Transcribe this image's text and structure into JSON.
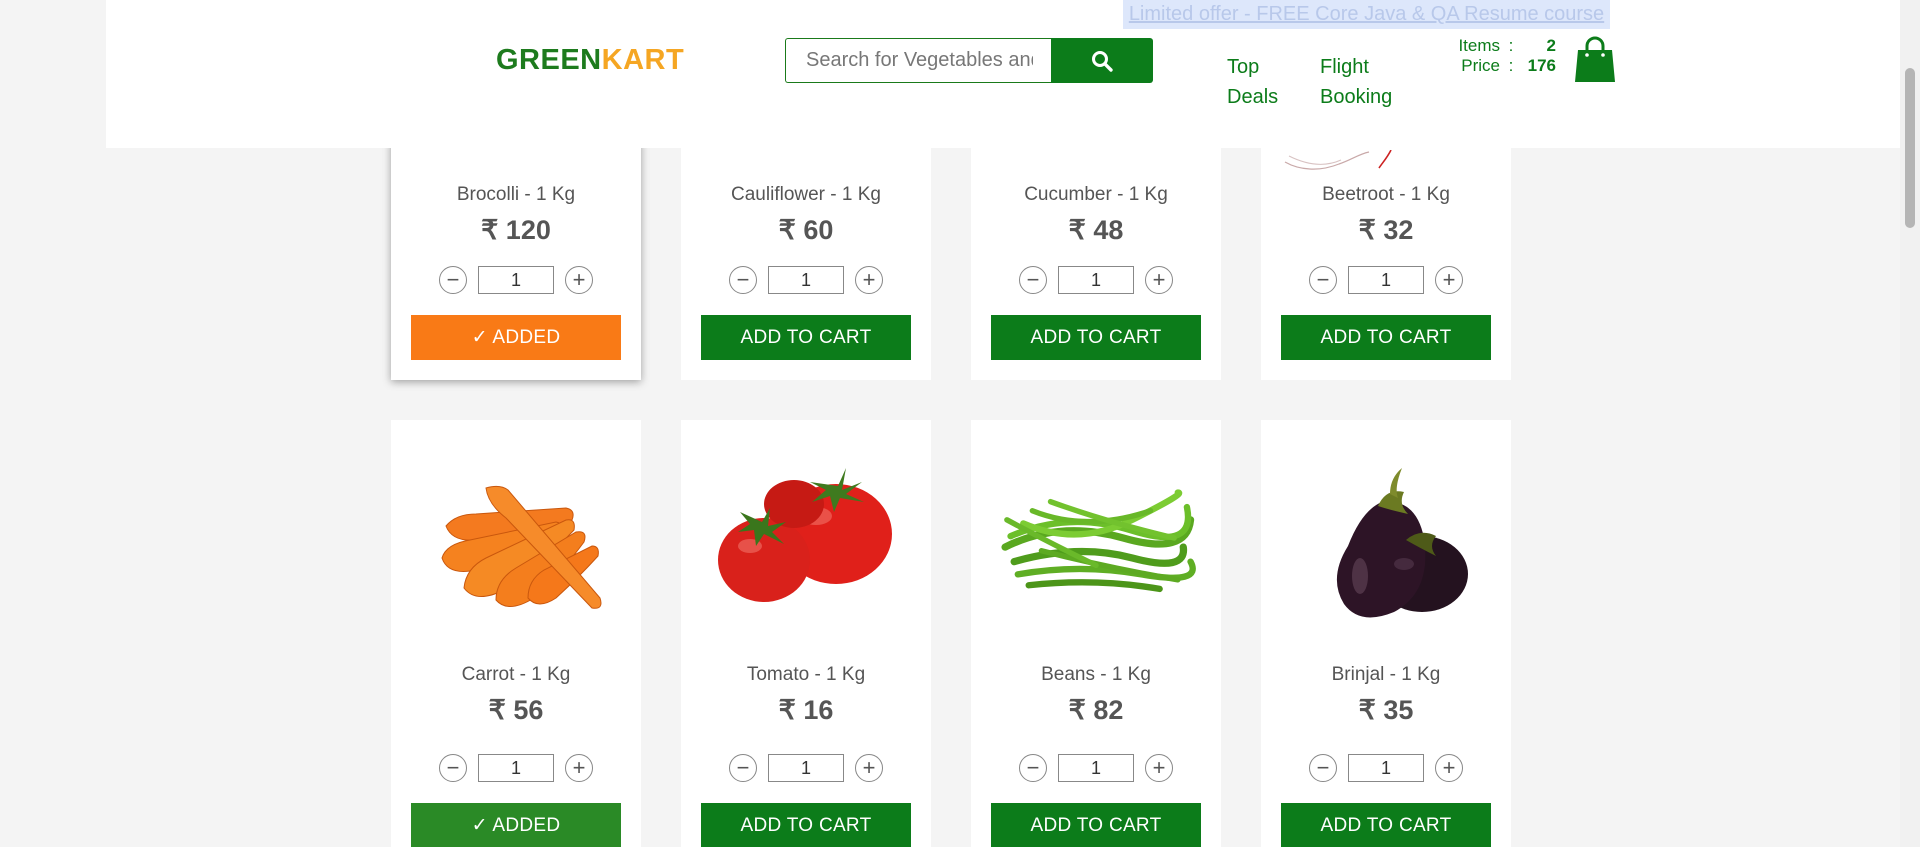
{
  "promo": {
    "text": "Limited offer - FREE Core Java & QA Resume course"
  },
  "header": {
    "brand_first": "GREEN",
    "brand_second": "KART",
    "search_placeholder": "Search for Vegetables and Fruits",
    "nav": {
      "top_deals_1": "Top",
      "top_deals_2": "Deals",
      "flight_1": "Flight",
      "flight_2": "Booking"
    },
    "cart": {
      "items_label": "Items",
      "items_value": "2",
      "price_label": "Price",
      "price_value": "176",
      "colon": ":"
    }
  },
  "products": [
    {
      "name": "Brocolli - 1 Kg",
      "price": "₹ 120",
      "qty": "1",
      "button": "✓ ADDED"
    },
    {
      "name": "Cauliflower - 1 Kg",
      "price": "₹ 60",
      "qty": "1",
      "button": "ADD TO CART"
    },
    {
      "name": "Cucumber - 1 Kg",
      "price": "₹ 48",
      "qty": "1",
      "button": "ADD TO CART"
    },
    {
      "name": "Beetroot - 1 Kg",
      "price": "₹ 32",
      "qty": "1",
      "button": "ADD TO CART"
    },
    {
      "name": "Carrot - 1 Kg",
      "price": "₹ 56",
      "qty": "1",
      "button": "✓ ADDED"
    },
    {
      "name": "Tomato - 1 Kg",
      "price": "₹ 16",
      "qty": "1",
      "button": "ADD TO CART"
    },
    {
      "name": "Beans - 1 Kg",
      "price": "₹ 82",
      "qty": "1",
      "button": "ADD TO CART"
    },
    {
      "name": "Brinjal - 1 Kg",
      "price": "₹ 35",
      "qty": "1",
      "button": "ADD TO CART"
    }
  ],
  "stepper": {
    "minus": "−",
    "plus": "+"
  },
  "colors": {
    "brand_green": "#0c7c1a",
    "added_orange": "#f97a16",
    "added_green": "#2a8a26",
    "accent_orange": "#f5a623"
  }
}
